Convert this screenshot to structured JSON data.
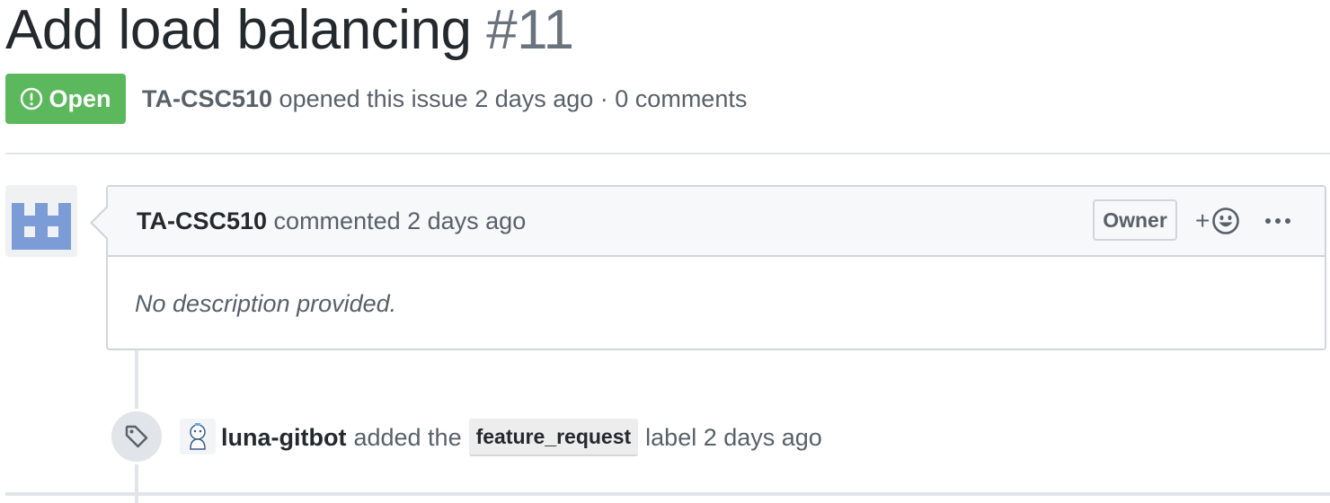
{
  "issue": {
    "title": "Add load balancing",
    "number": "#11",
    "state": "Open",
    "author": "TA-CSC510",
    "meta_text": " opened this issue 2 days ago · 0 comments"
  },
  "comment": {
    "author": "TA-CSC510",
    "action_text": " commented 2 days ago",
    "role_badge": "Owner",
    "reaction_plus": "+",
    "body": "No description provided."
  },
  "event": {
    "actor": "luna-gitbot",
    "action_text": "added the",
    "label": "feature_request",
    "suffix_text": "label 2 days ago"
  },
  "icons": {
    "state": "issue-opened-icon",
    "reaction": "smiley-icon",
    "more": "kebab-horizontal-icon",
    "event": "tag-icon"
  },
  "colors": {
    "open_badge": "#5cb85c",
    "label_bg": "#ededed",
    "identicon": "#7b9cd6"
  }
}
